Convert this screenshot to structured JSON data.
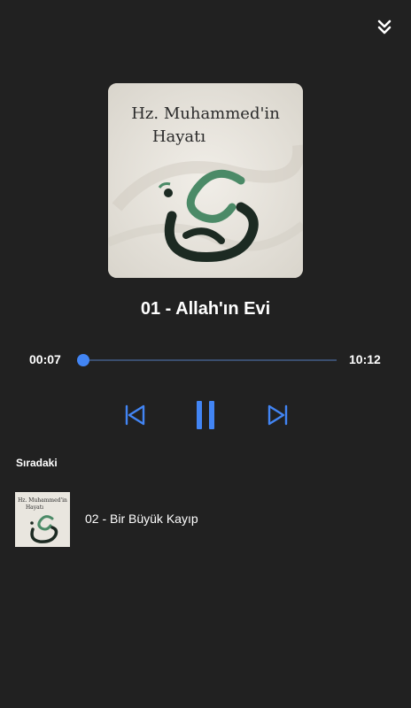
{
  "player": {
    "collapse_icon": "double-chevron-down-icon",
    "cover_text_line1": "Hz. Muhammed'in",
    "cover_text_line2": "Hayatı",
    "track_title": "01 - Allah'ın Evi",
    "current_time": "00:07",
    "total_time": "10:12",
    "progress": 0.011,
    "controls": {
      "previous_icon": "skip-previous-icon",
      "pause_icon": "pause-icon",
      "next_icon": "skip-next-icon"
    },
    "accent_color": "#4285f4",
    "background_color": "#212121"
  },
  "queue": {
    "header": "Sıradaki",
    "items": [
      {
        "title": "02 - Bir Büyük Kayıp"
      }
    ]
  }
}
